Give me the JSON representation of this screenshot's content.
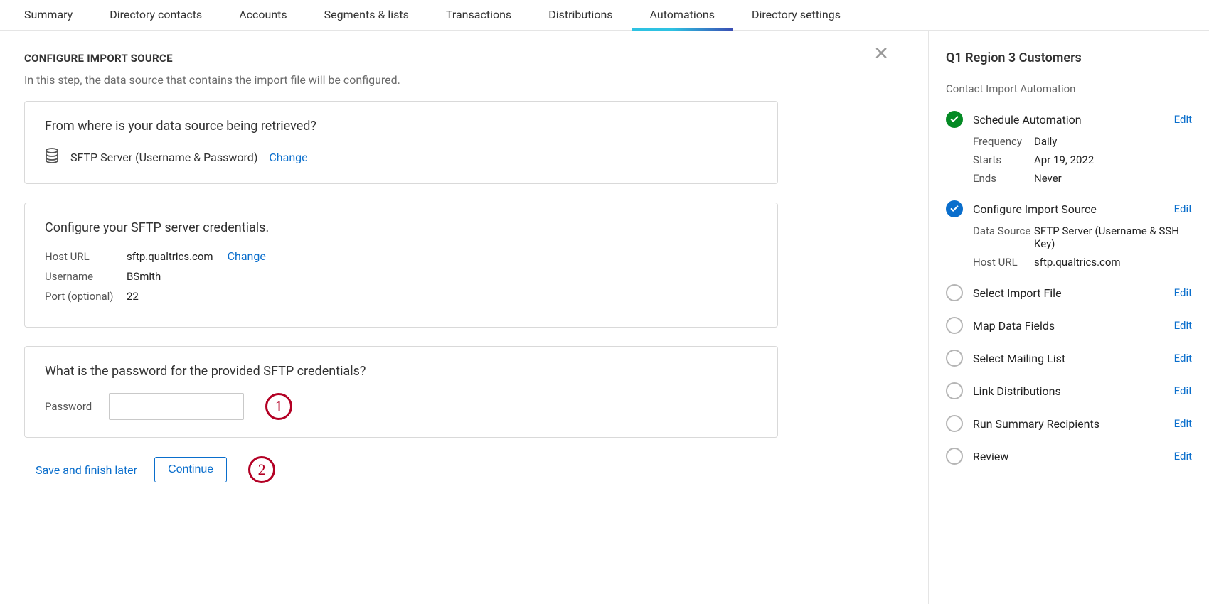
{
  "nav": [
    {
      "label": "Summary"
    },
    {
      "label": "Directory contacts"
    },
    {
      "label": "Accounts"
    },
    {
      "label": "Segments & lists"
    },
    {
      "label": "Transactions"
    },
    {
      "label": "Distributions"
    },
    {
      "label": "Automations"
    },
    {
      "label": "Directory settings"
    }
  ],
  "main": {
    "title": "CONFIGURE IMPORT SOURCE",
    "desc": "In this step, the data source that contains the import file will be configured.",
    "card1": {
      "title": "From where is your data source being retrieved?",
      "source": "SFTP Server (Username & Password)",
      "change": "Change"
    },
    "card2": {
      "title": "Configure your SFTP server credentials.",
      "rows": [
        {
          "k": "Host URL",
          "v": "sftp.qualtrics.com",
          "change": "Change"
        },
        {
          "k": "Username",
          "v": "BSmith"
        },
        {
          "k": "Port (optional)",
          "v": "22"
        }
      ]
    },
    "card3": {
      "title": "What is the password for the provided SFTP credentials?",
      "pw_label": "Password"
    },
    "actions": {
      "save_later": "Save and finish later",
      "continue": "Continue"
    },
    "annot1": "1",
    "annot2": "2"
  },
  "sidebar": {
    "title": "Q1 Region 3 Customers",
    "subtitle": "Contact Import Automation",
    "steps": [
      {
        "status": "done",
        "title": "Schedule Automation",
        "edit": "Edit",
        "details": [
          {
            "k": "Frequency",
            "v": "Daily"
          },
          {
            "k": "Starts",
            "v": "Apr 19, 2022"
          },
          {
            "k": "Ends",
            "v": "Never"
          }
        ]
      },
      {
        "status": "active",
        "title": "Configure Import Source",
        "edit": "Edit",
        "details": [
          {
            "k": "Data Source",
            "v": "SFTP Server (Username & SSH Key)"
          },
          {
            "k": "Host URL",
            "v": "sftp.qualtrics.com"
          }
        ]
      },
      {
        "status": "empty",
        "title": "Select Import File",
        "edit": "Edit"
      },
      {
        "status": "empty",
        "title": "Map Data Fields",
        "edit": "Edit"
      },
      {
        "status": "empty",
        "title": "Select Mailing List",
        "edit": "Edit"
      },
      {
        "status": "empty",
        "title": "Link Distributions",
        "edit": "Edit"
      },
      {
        "status": "empty",
        "title": "Run Summary Recipients",
        "edit": "Edit"
      },
      {
        "status": "empty",
        "title": "Review",
        "edit": "Edit"
      }
    ]
  }
}
